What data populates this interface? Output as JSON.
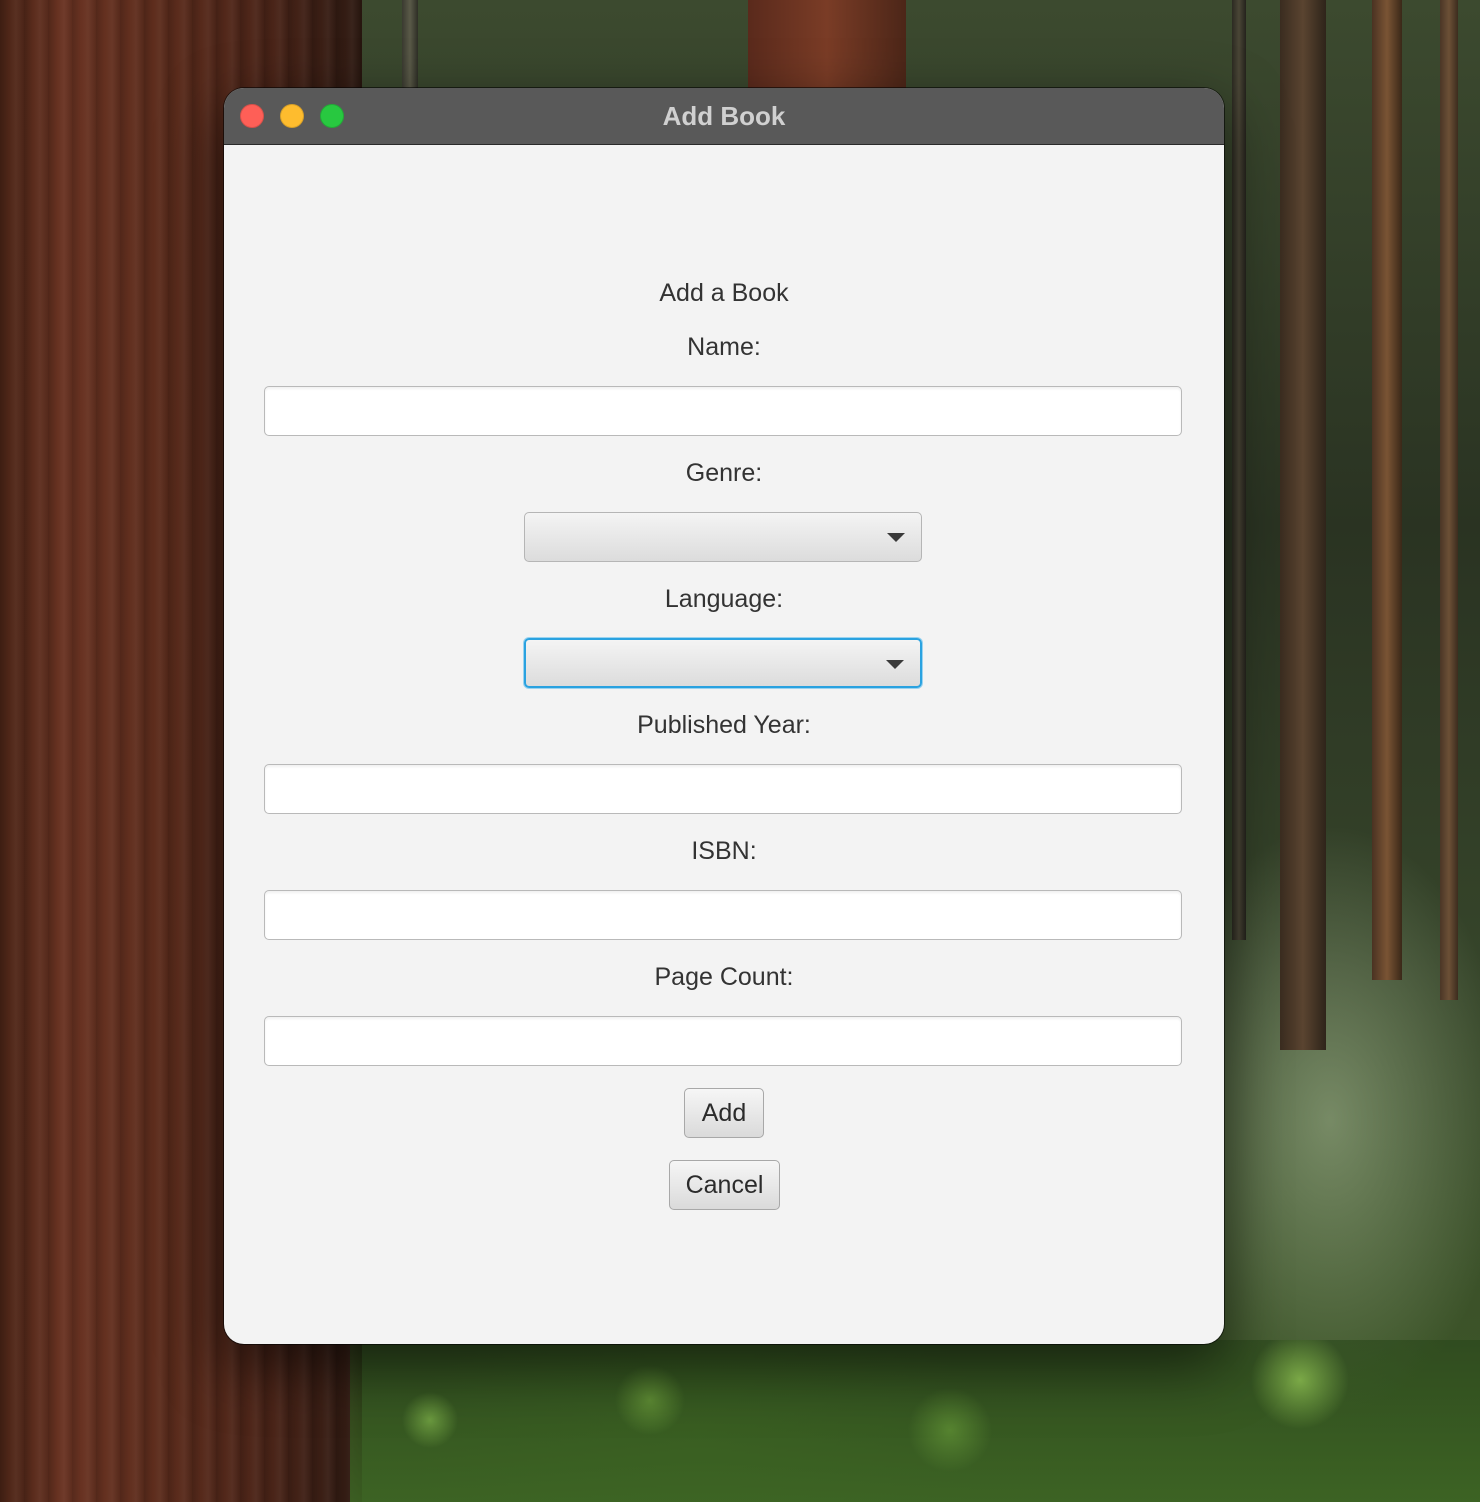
{
  "window": {
    "title": "Add Book"
  },
  "form": {
    "heading": "Add a Book",
    "name_label": "Name:",
    "name_value": "",
    "genre_label": "Genre:",
    "genre_value": "",
    "language_label": "Language:",
    "language_value": "",
    "published_year_label": "Published Year:",
    "published_year_value": "",
    "isbn_label": "ISBN:",
    "isbn_value": "",
    "page_count_label": "Page Count:",
    "page_count_value": ""
  },
  "buttons": {
    "add_label": "Add",
    "cancel_label": "Cancel"
  },
  "colors": {
    "titlebar": "#595959",
    "window_background": "#f3f3f3",
    "focus_ring": "#2aa2e0",
    "close": "#fe5f57",
    "minimize": "#febc2e",
    "maximize": "#28c840"
  },
  "icons": {
    "close": "close-icon",
    "minimize": "minimize-icon",
    "maximize": "maximize-icon",
    "dropdown": "chevron-down-icon"
  }
}
